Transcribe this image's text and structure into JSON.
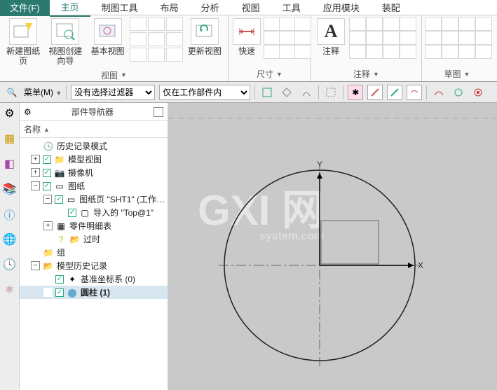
{
  "menu": {
    "file": "文件(F)",
    "tabs": [
      "主页",
      "制图工具",
      "布局",
      "分析",
      "视图",
      "工具",
      "应用模块",
      "装配"
    ]
  },
  "ribbon": {
    "group_view": {
      "label": "视图",
      "btn1": "新建图纸页",
      "btn2": "视图创建向导",
      "btn3": "基本视图",
      "btn4": "更新视图"
    },
    "group_dim": {
      "label": "尺寸",
      "btn1": "快速"
    },
    "group_annot": {
      "label": "注释",
      "btn1": "注释"
    },
    "group_sketch": {
      "label": "草图"
    }
  },
  "toolbar": {
    "menu_label": "菜单(M)",
    "filter1": "没有选择过滤器",
    "filter2": "仅在工作部件内"
  },
  "navigator": {
    "title": "部件导航器",
    "col_name": "名称"
  },
  "tree": {
    "history_mode": "历史记录模式",
    "model_views": "模型视图",
    "cameras": "摄像机",
    "drawings": "图纸",
    "sheet": "图纸页 \"SHT1\" (工作…",
    "imported": "导入的 \"Top@1\"",
    "parts_list": "零件明细表",
    "outdated": "过时",
    "groups": "组",
    "model_history": "模型历史记录",
    "datum_csys": "基准坐标系 (0)",
    "cylinder": "圆柱 (1)"
  },
  "canvas": {
    "x_label": "X",
    "y_label": "Y"
  },
  "watermark": {
    "main": "GXI 网",
    "sub": "system.com"
  }
}
